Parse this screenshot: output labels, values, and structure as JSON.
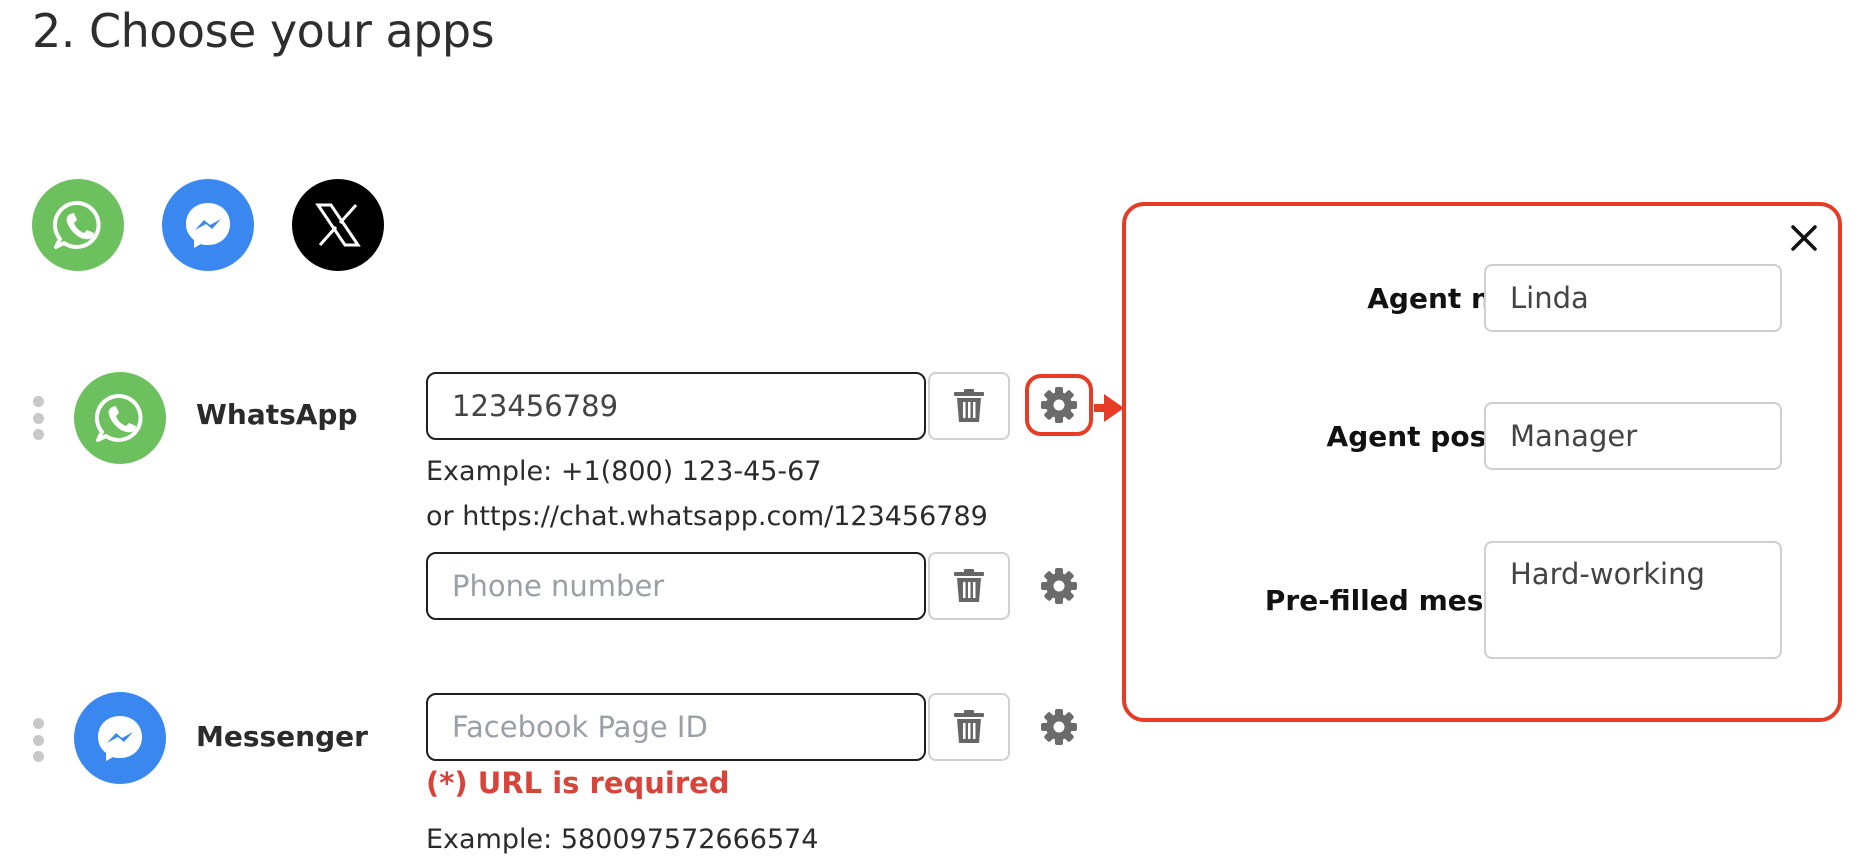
{
  "page": {
    "title": "2. Choose your apps"
  },
  "app_picker": [
    {
      "name": "whatsapp",
      "icon": "whatsapp-icon",
      "color": "#6cc05e"
    },
    {
      "name": "messenger",
      "icon": "messenger-icon",
      "color": "#3b87f0"
    },
    {
      "name": "x",
      "icon": "x-logo-icon",
      "color": "#000000"
    }
  ],
  "whatsapp": {
    "name": "WhatsApp",
    "input1": {
      "value": "123456789",
      "placeholder": "Phone number"
    },
    "hint_line1": "Example: +1(800) 123-45-67",
    "hint_line2": "or https://chat.whatsapp.com/123456789",
    "input2": {
      "value": "",
      "placeholder": "Phone number"
    }
  },
  "messenger": {
    "name": "Messenger",
    "input": {
      "value": "",
      "placeholder": "Facebook Page ID"
    },
    "error": "(*) URL is required",
    "hint": "Example: 580097572666574"
  },
  "settings_panel": {
    "accent_color": "#e63b25",
    "agent_name": {
      "label": "Agent name",
      "value": "Linda"
    },
    "agent_position": {
      "label": "Agent position",
      "value": "Manager"
    },
    "prefilled_message": {
      "label": "Pre-filled message",
      "value": "Hard-working"
    }
  }
}
